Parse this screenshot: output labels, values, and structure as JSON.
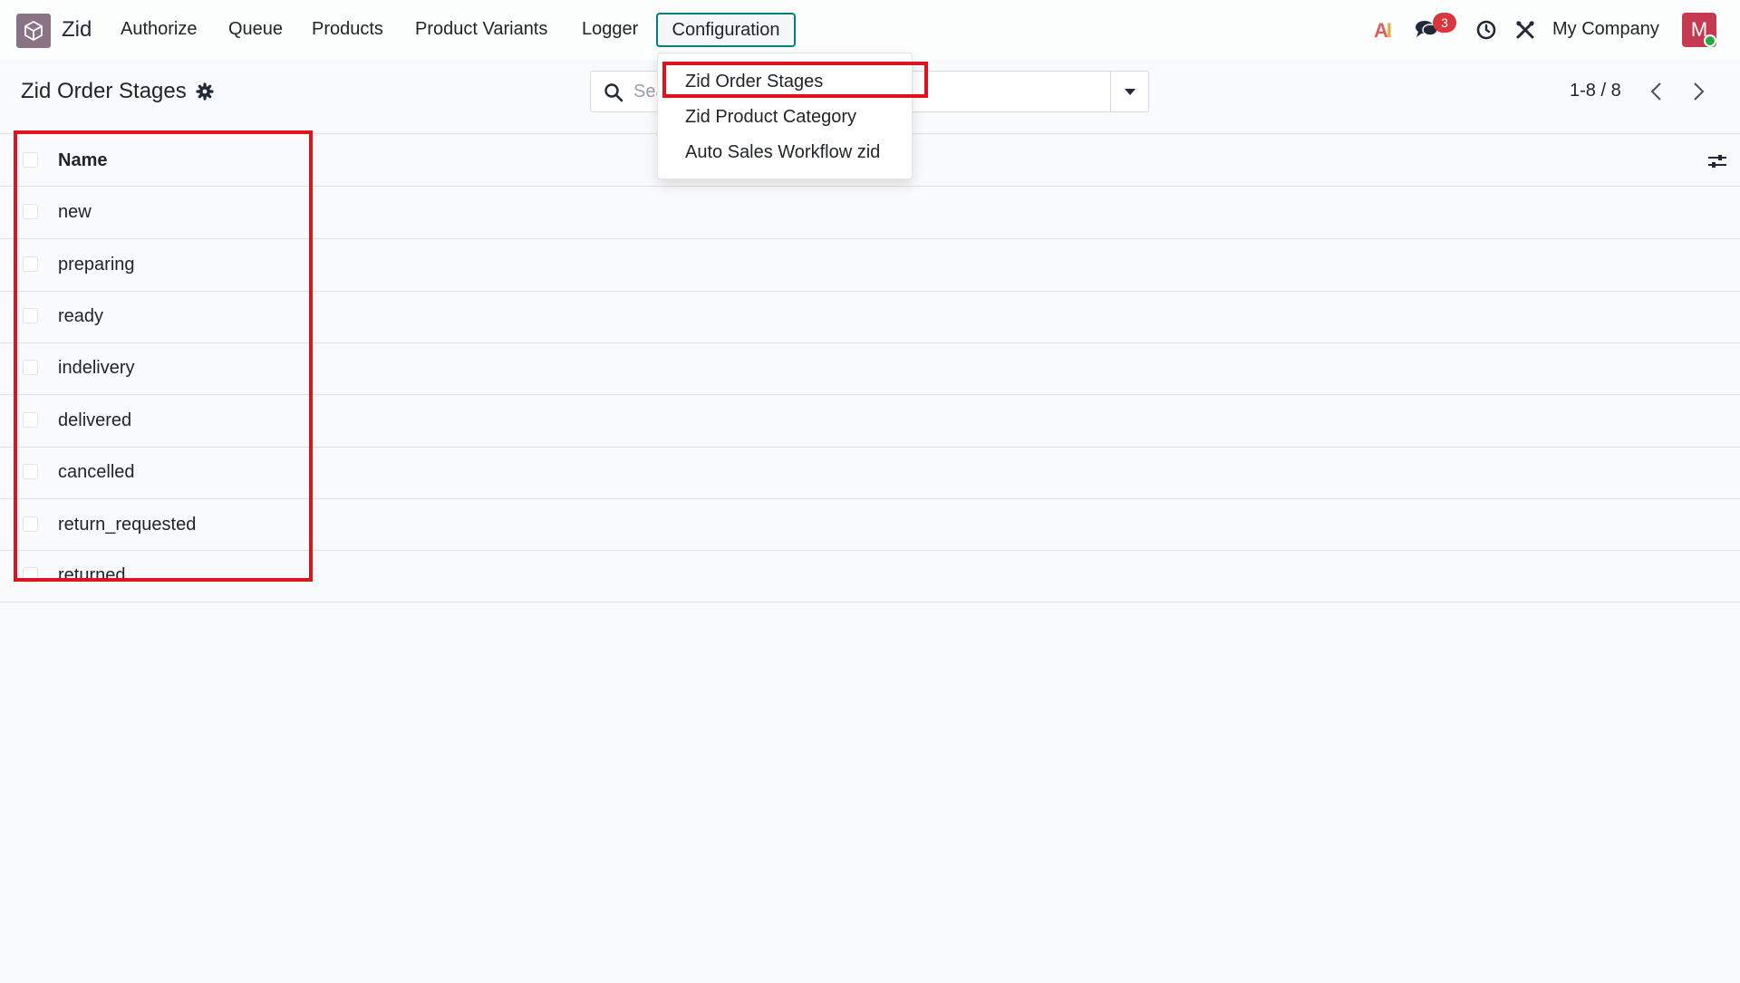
{
  "navbar": {
    "app_name": "Zid",
    "menu": [
      "Authorize",
      "Queue",
      "Products",
      "Product Variants",
      "Logger",
      "Configuration"
    ],
    "ai_label": "AI",
    "messages_badge": "3",
    "company": "My Company",
    "avatar_initial": "M"
  },
  "control_panel": {
    "title": "Zid Order Stages",
    "search_placeholder": "Search...",
    "pager": "1-8 / 8"
  },
  "list": {
    "column_header": "Name",
    "rows": [
      "new",
      "preparing",
      "ready",
      "indelivery",
      "delivered",
      "cancelled",
      "return_requested",
      "returned"
    ]
  },
  "configuration_dropdown": {
    "items": [
      "Zid Order Stages",
      "Zid Product Category",
      "Auto Sales Workflow zid"
    ]
  },
  "colors": {
    "accent": "#017e84",
    "highlight": "#e0121e",
    "avatar": "#c43a51",
    "badge": "#d9363e"
  }
}
